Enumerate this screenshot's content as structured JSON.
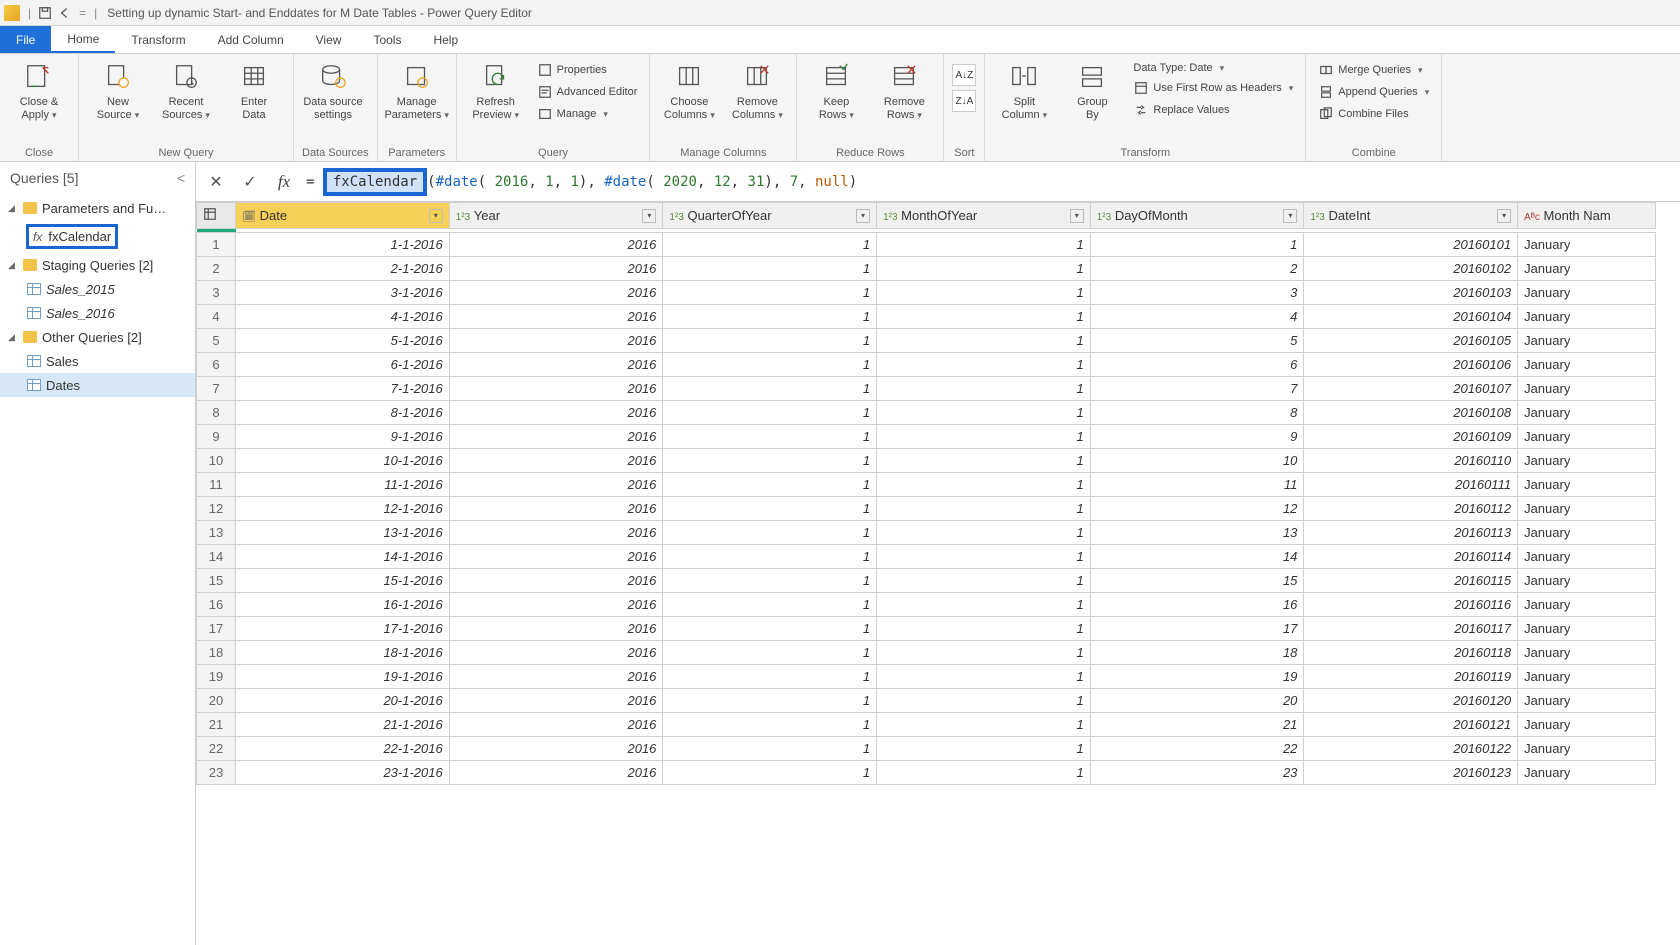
{
  "titlebar": {
    "title": "Setting up dynamic Start- and Enddates for M Date Tables - Power Query Editor"
  },
  "menu": {
    "file": "File",
    "home": "Home",
    "transform": "Transform",
    "addcolumn": "Add Column",
    "view": "View",
    "tools": "Tools",
    "help": "Help"
  },
  "ribbon": {
    "close_apply": "Close &\nApply",
    "close_group": "Close",
    "new_source": "New\nSource",
    "recent_sources": "Recent\nSources",
    "enter_data": "Enter\nData",
    "new_query_group": "New Query",
    "data_source_settings": "Data source\nsettings",
    "data_sources_group": "Data Sources",
    "manage_parameters": "Manage\nParameters",
    "parameters_group": "Parameters",
    "refresh_preview": "Refresh\nPreview",
    "properties": "Properties",
    "advanced_editor": "Advanced Editor",
    "manage": "Manage",
    "query_group": "Query",
    "choose_columns": "Choose\nColumns",
    "remove_columns": "Remove\nColumns",
    "manage_columns_group": "Manage Columns",
    "keep_rows": "Keep\nRows",
    "remove_rows": "Remove\nRows",
    "reduce_rows_group": "Reduce Rows",
    "sort_group": "Sort",
    "split_column": "Split\nColumn",
    "group_by": "Group\nBy",
    "data_type": "Data Type: Date",
    "first_row_headers": "Use First Row as Headers",
    "replace_values": "Replace Values",
    "transform_group": "Transform",
    "merge_queries": "Merge Queries",
    "append_queries": "Append Queries",
    "combine_files": "Combine Files",
    "combine_group": "Combine"
  },
  "sidebar": {
    "header": "Queries [5]",
    "group1": "Parameters and Fu…",
    "fxcalendar": "fxCalendar",
    "group2": "Staging Queries [2]",
    "sales2015": "Sales_2015",
    "sales2016": "Sales_2016",
    "group3": "Other Queries [2]",
    "sales": "Sales",
    "dates": "Dates"
  },
  "formula": {
    "function_name": "fxCalendar",
    "prefix_paren": "(",
    "date_kw": "#date",
    "y1": "2016",
    "m1": "1",
    "d1": "1",
    "y2": "2020",
    "m2": "12",
    "d2": "31",
    "seven": "7",
    "null_kw": "null"
  },
  "columns": {
    "date": "Date",
    "year": "Year",
    "quarter": "QuarterOfYear",
    "month": "MonthOfYear",
    "day": "DayOfMonth",
    "dateint": "DateInt",
    "monthname": "Month Nam"
  },
  "rows": [
    {
      "n": 1,
      "date": "1-1-2016",
      "year": 2016,
      "q": 1,
      "m": 1,
      "d": 1,
      "di": 20160101,
      "mn": "January"
    },
    {
      "n": 2,
      "date": "2-1-2016",
      "year": 2016,
      "q": 1,
      "m": 1,
      "d": 2,
      "di": 20160102,
      "mn": "January"
    },
    {
      "n": 3,
      "date": "3-1-2016",
      "year": 2016,
      "q": 1,
      "m": 1,
      "d": 3,
      "di": 20160103,
      "mn": "January"
    },
    {
      "n": 4,
      "date": "4-1-2016",
      "year": 2016,
      "q": 1,
      "m": 1,
      "d": 4,
      "di": 20160104,
      "mn": "January"
    },
    {
      "n": 5,
      "date": "5-1-2016",
      "year": 2016,
      "q": 1,
      "m": 1,
      "d": 5,
      "di": 20160105,
      "mn": "January"
    },
    {
      "n": 6,
      "date": "6-1-2016",
      "year": 2016,
      "q": 1,
      "m": 1,
      "d": 6,
      "di": 20160106,
      "mn": "January"
    },
    {
      "n": 7,
      "date": "7-1-2016",
      "year": 2016,
      "q": 1,
      "m": 1,
      "d": 7,
      "di": 20160107,
      "mn": "January"
    },
    {
      "n": 8,
      "date": "8-1-2016",
      "year": 2016,
      "q": 1,
      "m": 1,
      "d": 8,
      "di": 20160108,
      "mn": "January"
    },
    {
      "n": 9,
      "date": "9-1-2016",
      "year": 2016,
      "q": 1,
      "m": 1,
      "d": 9,
      "di": 20160109,
      "mn": "January"
    },
    {
      "n": 10,
      "date": "10-1-2016",
      "year": 2016,
      "q": 1,
      "m": 1,
      "d": 10,
      "di": 20160110,
      "mn": "January"
    },
    {
      "n": 11,
      "date": "11-1-2016",
      "year": 2016,
      "q": 1,
      "m": 1,
      "d": 11,
      "di": 20160111,
      "mn": "January"
    },
    {
      "n": 12,
      "date": "12-1-2016",
      "year": 2016,
      "q": 1,
      "m": 1,
      "d": 12,
      "di": 20160112,
      "mn": "January"
    },
    {
      "n": 13,
      "date": "13-1-2016",
      "year": 2016,
      "q": 1,
      "m": 1,
      "d": 13,
      "di": 20160113,
      "mn": "January"
    },
    {
      "n": 14,
      "date": "14-1-2016",
      "year": 2016,
      "q": 1,
      "m": 1,
      "d": 14,
      "di": 20160114,
      "mn": "January"
    },
    {
      "n": 15,
      "date": "15-1-2016",
      "year": 2016,
      "q": 1,
      "m": 1,
      "d": 15,
      "di": 20160115,
      "mn": "January"
    },
    {
      "n": 16,
      "date": "16-1-2016",
      "year": 2016,
      "q": 1,
      "m": 1,
      "d": 16,
      "di": 20160116,
      "mn": "January"
    },
    {
      "n": 17,
      "date": "17-1-2016",
      "year": 2016,
      "q": 1,
      "m": 1,
      "d": 17,
      "di": 20160117,
      "mn": "January"
    },
    {
      "n": 18,
      "date": "18-1-2016",
      "year": 2016,
      "q": 1,
      "m": 1,
      "d": 18,
      "di": 20160118,
      "mn": "January"
    },
    {
      "n": 19,
      "date": "19-1-2016",
      "year": 2016,
      "q": 1,
      "m": 1,
      "d": 19,
      "di": 20160119,
      "mn": "January"
    },
    {
      "n": 20,
      "date": "20-1-2016",
      "year": 2016,
      "q": 1,
      "m": 1,
      "d": 20,
      "di": 20160120,
      "mn": "January"
    },
    {
      "n": 21,
      "date": "21-1-2016",
      "year": 2016,
      "q": 1,
      "m": 1,
      "d": 21,
      "di": 20160121,
      "mn": "January"
    },
    {
      "n": 22,
      "date": "22-1-2016",
      "year": 2016,
      "q": 1,
      "m": 1,
      "d": 22,
      "di": 20160122,
      "mn": "January"
    },
    {
      "n": 23,
      "date": "23-1-2016",
      "year": 2016,
      "q": 1,
      "m": 1,
      "d": 23,
      "di": 20160123,
      "mn": "January"
    }
  ]
}
